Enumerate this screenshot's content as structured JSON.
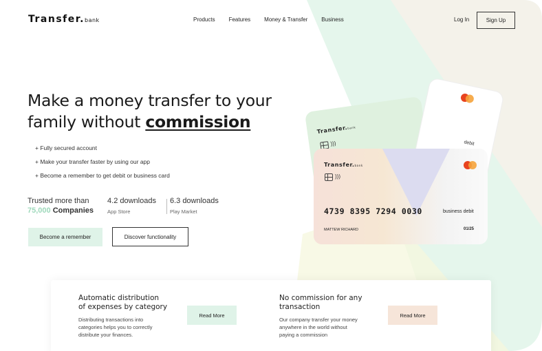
{
  "brand": {
    "name": "Transfer.",
    "suffix": "bank"
  },
  "nav": {
    "links": [
      "Products",
      "Features",
      "Money & Transfer",
      "Business"
    ],
    "login": "Log In",
    "signup": "Sign Up"
  },
  "hero": {
    "title_line1": "Make a money transfer to your",
    "title_line2_prefix": "family without ",
    "title_highlight": "commission",
    "features": [
      "+ Fully secured account",
      "+ Make your transfer faster by using our app",
      "+ Become a remember to get debit or business card"
    ],
    "stats": {
      "trusted_prefix": "Trusted more than",
      "trusted_number": "75,000",
      "trusted_suffix": " Companies",
      "app_store_downloads": "4.2 downloads",
      "app_store_label": "App Store",
      "play_market_downloads": "6.3 downloads",
      "play_market_label": "Play Market"
    },
    "primary_button": "Become a remember",
    "secondary_button": "Discover functionality"
  },
  "cards": {
    "logo": "Transfer.",
    "logo_suffix": "bank",
    "debit_label": "debit",
    "number": "4739 8395 7294 0030",
    "type": "business debit",
    "holder": "MATTEW RICHARD",
    "expiry": "01/25"
  },
  "feature_blocks": [
    {
      "title_line1": "Automatic distribution",
      "title_line2": "of expenses by category",
      "desc_line1": "Distributing transactions into",
      "desc_line2": "categories helps you to correctly",
      "desc_line3": "distribute your finances.",
      "button": "Read More"
    },
    {
      "title_line1": "No commission for any",
      "title_line2": "transaction",
      "desc_line1": "Our company transfer your money",
      "desc_line2": "anywhere in the world without",
      "desc_line3": "paying a commission",
      "button": "Read More"
    }
  ],
  "colors": {
    "mint": "#dff3e8",
    "peach": "#f6e5d9",
    "lavender": "#dcdcf0",
    "accent_green": "#9ed9bb",
    "mastercard_red": "#e8431f",
    "mastercard_orange": "#f5a33b"
  },
  "icons": [
    "chip-icon",
    "contactless-icon",
    "mastercard-icon"
  ]
}
